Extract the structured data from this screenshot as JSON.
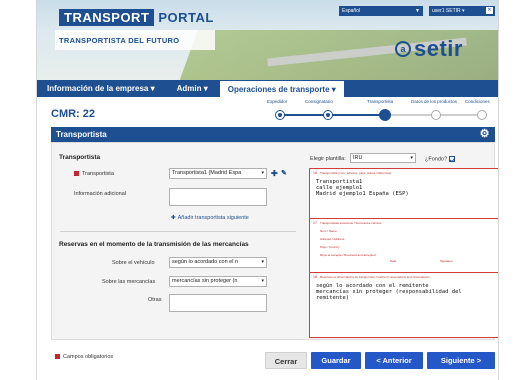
{
  "header": {
    "logo_box": "TRANSPORT",
    "logo_portal": "PORTAL",
    "subtitle": "TRANSPORTISTA DEL FUTURO",
    "language": "Español",
    "user": "user1 SETIR ▾",
    "brand_mark": "a",
    "brand_name": "setir"
  },
  "nav": {
    "items": [
      {
        "label": "Información de la empresa ▾"
      },
      {
        "label": "Admin ▾"
      },
      {
        "label": "Operaciones de transporte ▾"
      }
    ]
  },
  "page": {
    "title": "CMR: 22"
  },
  "stepper": {
    "steps": [
      {
        "label": "Expedidor",
        "state": "done"
      },
      {
        "label": "Consignatario",
        "state": "done"
      },
      {
        "label": "Transportista",
        "state": "current"
      },
      {
        "label": "Datos de los productos",
        "state": "todo"
      },
      {
        "label": "Condiciones",
        "state": "todo"
      }
    ]
  },
  "section": {
    "title": "Transportista"
  },
  "form": {
    "carrier_heading": "Transportista",
    "carrier_label": "Transportista",
    "carrier_value": "Transportista1 (Madrid Espa",
    "additional_info_label": "Información adicional",
    "add_carrier_link": "Añadir transportista siguiente",
    "reserves_heading": "Reservas en el momento de la transmisión de las mercancías",
    "vehicle_label": "Sobre el vehículo",
    "vehicle_value": "según lo acordado con el n",
    "goods_label": "Sobre las mercancías",
    "goods_value": "mercancías sin proteger (n",
    "others_label": "Otras"
  },
  "preview": {
    "template_label": "Elegir plantilla:",
    "template_value": "IRU",
    "background_label": "¿Fondo?",
    "box16_num": "16",
    "box16_tiny": "Transportista (nom, adresse, pays, autres références)",
    "box16_text": "Transportista1\ncalle ejemplo1\nMadrid ejemplo1 España (ESP)",
    "box17_num": "17",
    "box17_tiny": "Transportistas sucesivos / Successive carriers",
    "box17_lines": [
      "Nom / Name",
      "Adresse / Address",
      "Pays / Country",
      "Reçu et accepté / Received and accepted",
      "Date",
      "Signature"
    ],
    "box18_num": "18",
    "box18_tiny": "Réserves et observations du transporteur / Carrier's reservations and observations",
    "box18_text": "según lo acordado con el remitente\nmercancías sin proteger (responsabilidad del\nremitente)"
  },
  "footer": {
    "required_note": "Campos obligatorios",
    "close": "Cerrar",
    "save": "Guardar",
    "previous": "< Anterior",
    "next": "Siguiente >"
  },
  "colors": {
    "brand": "#1d4f91",
    "required": "#c1272d",
    "button": "#2457c8"
  }
}
